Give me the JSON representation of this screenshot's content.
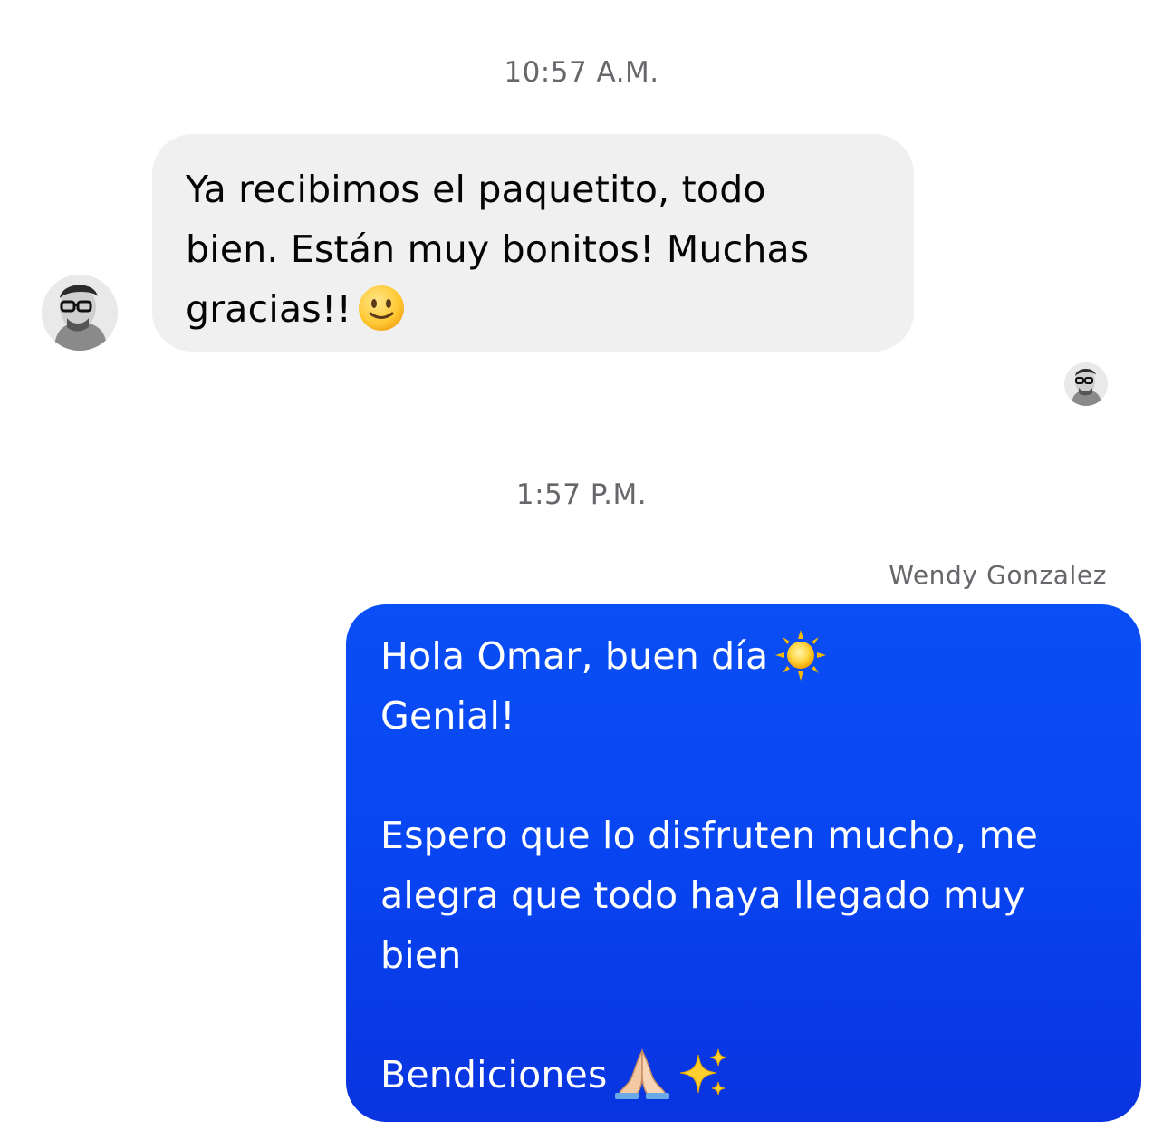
{
  "conversation": {
    "messages": [
      {
        "timestamp": "10:57 A.M.",
        "direction": "incoming",
        "avatar_icon": "user-avatar-icon",
        "lines": [
          "Ya recibimos el paquetito, todo",
          "bien. Están muy bonitos! Muchas",
          "gracias!!"
        ],
        "trailing_emoji": "slightly-smiling-face-icon",
        "seen_avatar_icon": "seen-avatar-icon"
      },
      {
        "timestamp": "1:57 P.M.",
        "direction": "outgoing",
        "sender_name": "Wendy Gonzalez",
        "lines": [
          "Hola Omar, buen día",
          "Genial!",
          "",
          "Espero que lo disfruten mucho, me",
          "alegra que todo haya llegado muy",
          "bien",
          "",
          "Bendiciones"
        ],
        "emojis": [
          "sun-icon",
          "folded-hands-icon",
          "sparkles-icon"
        ]
      }
    ]
  },
  "colors": {
    "incoming_bubble": "#f0f0f0",
    "outgoing_bubble": "#0a4ef5",
    "timestamp_text": "#65676b",
    "incoming_text": "#050505",
    "outgoing_text": "#ffffff"
  }
}
